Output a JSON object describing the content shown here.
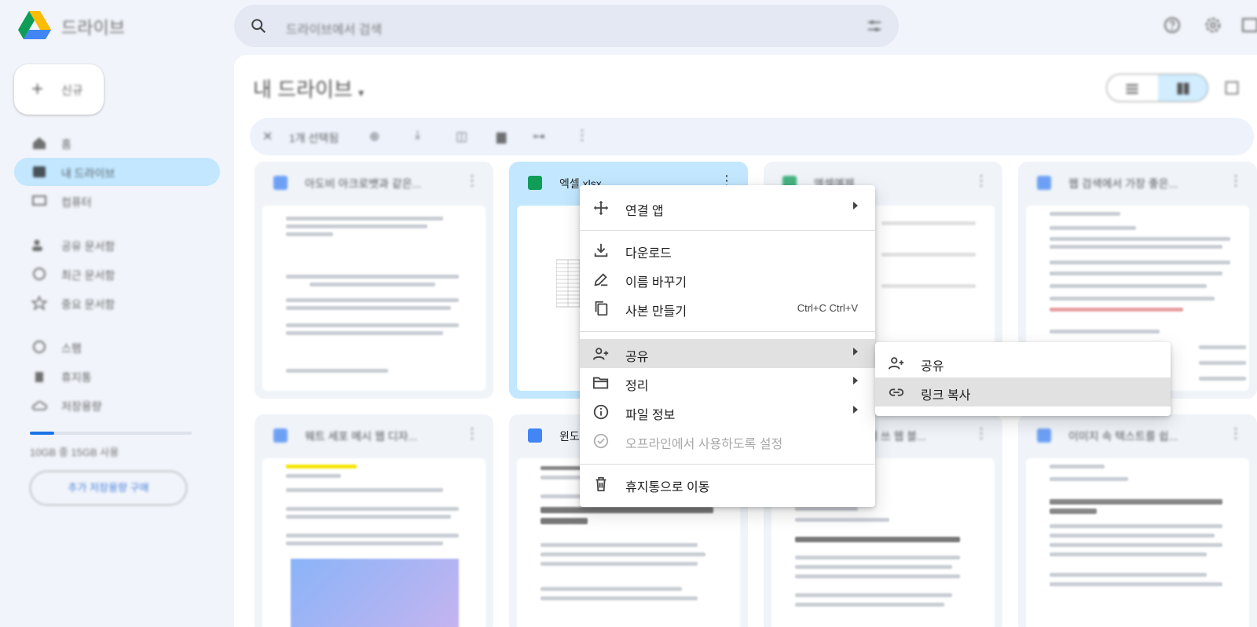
{
  "header": {
    "brand": "드라이브",
    "search_placeholder": "드라이브에서 검색"
  },
  "sidebar": {
    "new_label": "신규",
    "items": [
      {
        "label": "홈",
        "icon": "home-icon"
      },
      {
        "label": "내 드라이브",
        "icon": "drive-icon",
        "active": true
      },
      {
        "label": "컴퓨터",
        "icon": "computer-icon"
      },
      {
        "label": "공유 문서함",
        "icon": "people-icon"
      },
      {
        "label": "최근 문서함",
        "icon": "clock-icon"
      },
      {
        "label": "중요 문서함",
        "icon": "star-icon"
      },
      {
        "label": "스팸",
        "icon": "spam-icon"
      },
      {
        "label": "휴지통",
        "icon": "trash-icon"
      },
      {
        "label": "저장용량",
        "icon": "cloud-icon"
      }
    ],
    "storage_text": "10GB 중 15GB 사용",
    "storage_fraction": 0.15,
    "buy_label": "추가 저장용량 구매"
  },
  "main": {
    "title": "내 드라이브",
    "selection_text": "1개 선택됨"
  },
  "cards": [
    {
      "title": "아도비 아크로뱃과 같은...",
      "type": "doc"
    },
    {
      "title": "엑셀.xlsx",
      "type": "sheet",
      "selected": true
    },
    {
      "title": "엑셀예제",
      "type": "sheet"
    },
    {
      "title": "웹 검색에서 가장 좋은...",
      "type": "doc"
    },
    {
      "title": "웨트 세포 메시 웹 디자...",
      "type": "doc"
    },
    {
      "title": "윈도",
      "type": "doc"
    },
    {
      "title": "세 쓰 웹 블...",
      "type": "doc"
    },
    {
      "title": "이미지 속 텍스트를 쉽...",
      "type": "doc"
    }
  ],
  "context_menu": {
    "items": [
      {
        "label": "연결 앱",
        "icon": "open-with-icon",
        "arrow": true
      },
      {
        "label": "다운로드",
        "icon": "download-icon"
      },
      {
        "label": "이름 바꾸기",
        "icon": "rename-icon"
      },
      {
        "label": "사본 만들기",
        "icon": "copy-icon",
        "shortcut": "Ctrl+C Ctrl+V"
      },
      {
        "label": "공유",
        "icon": "person-add-icon",
        "arrow": true,
        "highlight": true
      },
      {
        "label": "정리",
        "icon": "folder-icon",
        "arrow": true
      },
      {
        "label": "파일 정보",
        "icon": "info-icon",
        "arrow": true
      },
      {
        "label": "오프라인에서 사용하도록 설정",
        "icon": "offline-check-icon",
        "disabled": true
      },
      {
        "label": "휴지통으로 이동",
        "icon": "trash-icon"
      }
    ]
  },
  "share_submenu": {
    "items": [
      {
        "label": "공유",
        "icon": "person-add-icon"
      },
      {
        "label": "링크 복사",
        "icon": "link-icon",
        "highlight": true
      }
    ]
  },
  "colors": {
    "accent": "#0b57d0",
    "selected_bg": "#c2e7ff",
    "doc_blue": "#4285f4",
    "sheet_green": "#0f9d58"
  }
}
